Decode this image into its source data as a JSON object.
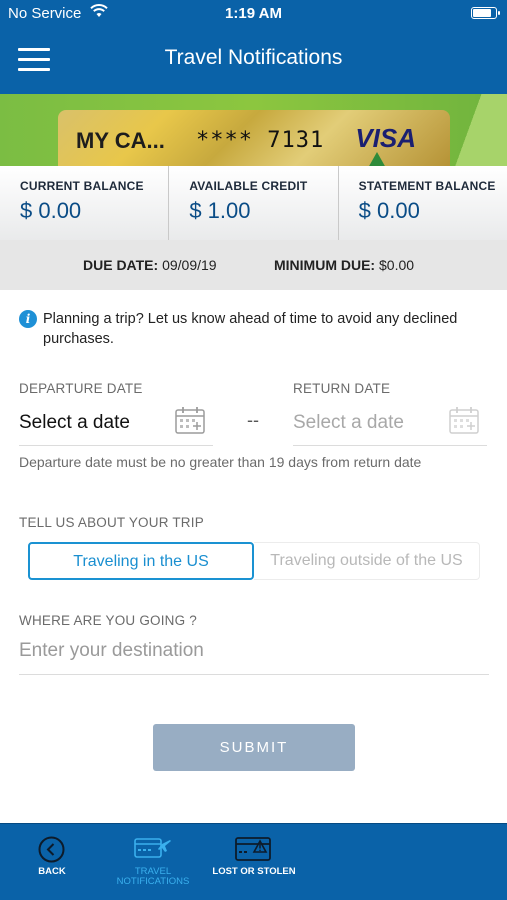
{
  "status_bar": {
    "carrier": "No Service",
    "time": "1:19 AM"
  },
  "header": {
    "title": "Travel Notifications"
  },
  "card": {
    "name": "MY CA...",
    "number": "**** 7131",
    "brand": "VISA"
  },
  "balances": [
    {
      "label": "CURRENT BALANCE",
      "value": "$ 0.00"
    },
    {
      "label": "AVAILABLE CREDIT",
      "value": "$ 1.00"
    },
    {
      "label": "STATEMENT BALANCE",
      "value": "$ 0.00"
    }
  ],
  "dues": {
    "due_date_label": "DUE DATE:",
    "due_date": "09/09/19",
    "min_due_label": "MINIMUM DUE:",
    "min_due": "$0.00"
  },
  "info": {
    "text": "Planning a trip? Let us know ahead of time to avoid any declined purchases."
  },
  "departure": {
    "label": "DEPARTURE DATE",
    "value": "Select a date"
  },
  "separator": "--",
  "return": {
    "label": "RETURN DATE",
    "value": "Select a date"
  },
  "hint": "Departure date must be no greater than 19 days from return date",
  "trip": {
    "label": "TELL US ABOUT YOUR TRIP",
    "options": [
      "Traveling in the US",
      "Traveling outside of the US"
    ],
    "selected": "Traveling in the US"
  },
  "destination": {
    "label": "WHERE ARE YOU GOING ?",
    "placeholder": "Enter your destination"
  },
  "submit_label": "SUBMIT",
  "tabs": [
    {
      "label": "BACK",
      "icon": "back-arrow-icon"
    },
    {
      "label": "TRAVEL NOTIFICATIONS",
      "icon": "card-plane-icon",
      "active": true
    },
    {
      "label": "LOST OR STOLEN",
      "icon": "card-warning-icon"
    }
  ],
  "colors": {
    "brand_blue": "#0a62a8",
    "accent_blue": "#1a92d2",
    "submit_disabled": "#98adc3"
  }
}
